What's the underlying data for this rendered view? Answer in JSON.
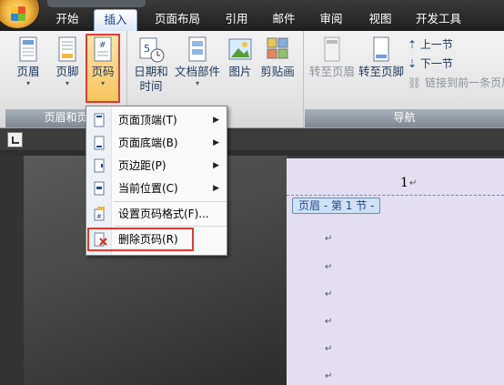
{
  "tabs": [
    "开始",
    "插入",
    "页面布局",
    "引用",
    "邮件",
    "审阅",
    "视图",
    "开发工具"
  ],
  "active_tab": "插入",
  "ribbon": {
    "header_footer_group": {
      "label": "页眉和页",
      "header": "页眉",
      "footer": "页脚",
      "page_number": "页码"
    },
    "insert_group": {
      "date_time_line1": "日期和",
      "date_time_line2": "时间",
      "doc_parts": "文档部件",
      "picture": "图片",
      "clipart": "剪贴画"
    },
    "navigation_group": {
      "label": "导航",
      "goto_header": "转至页眉",
      "goto_footer": "转至页脚",
      "prev_section": "上一节",
      "next_section": "下一节",
      "link_previous": "链接到前一条页眉"
    }
  },
  "menu": {
    "items": [
      {
        "label": "页面顶端(T)",
        "icon": "page-top-icon",
        "submenu": true
      },
      {
        "label": "页面底端(B)",
        "icon": "page-bottom-icon",
        "submenu": true
      },
      {
        "label": "页边距(P)",
        "icon": "page-margin-icon",
        "submenu": true
      },
      {
        "label": "当前位置(C)",
        "icon": "current-position-icon",
        "submenu": true
      },
      {
        "label": "设置页码格式(F)...",
        "icon": "format-page-number-icon",
        "submenu": false
      },
      {
        "label": "删除页码(R)",
        "icon": "remove-page-number-icon",
        "submenu": false
      }
    ],
    "submenu_arrow": "▶"
  },
  "document": {
    "page_number": "1",
    "header_tag": "页眉 - 第 1 节 -",
    "para_mark": "↵"
  },
  "colors": {
    "highlight": "#e23b35",
    "ribbon_bg": "#e3e3e3",
    "page_bg": "#e3dff0"
  }
}
